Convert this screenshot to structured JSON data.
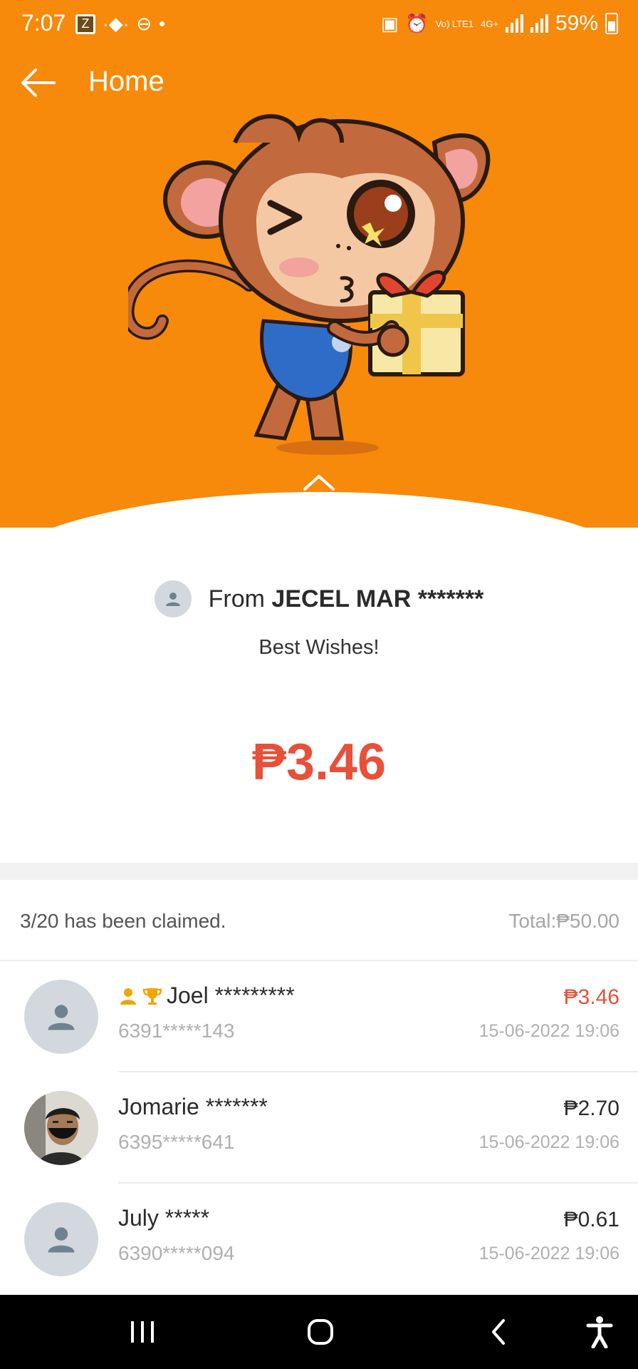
{
  "status_bar": {
    "time": "7:07",
    "carrier_badge": "Z",
    "lte_label": "Vo) LTE1",
    "net_label": "4G+",
    "battery": "59%"
  },
  "app_bar": {
    "title": "Home"
  },
  "sender": {
    "prefix": "From",
    "name": "JECEL MAR *******",
    "message": "Best Wishes!"
  },
  "received_amount": "₱3.46",
  "claims": {
    "summary": "3/20 has been claimed.",
    "total": "Total:₱50.00",
    "items": [
      {
        "name": "Joel *********",
        "phone": "6391*****143",
        "amount": "₱3.46",
        "time": "15-06-2022 19:06",
        "best": true
      },
      {
        "name": "Jomarie *******",
        "phone": "6395*****641",
        "amount": "₱2.70",
        "time": "15-06-2022 19:06",
        "best": false
      },
      {
        "name": "July *****",
        "phone": "6390*****094",
        "amount": "₱0.61",
        "time": "15-06-2022 19:06",
        "best": false
      }
    ]
  },
  "colors": {
    "brand_orange": "#f7890b",
    "amount_red": "#e8503a",
    "badge_gold": "#f0a500"
  },
  "icons": [
    "back-arrow-icon",
    "chevron-up-icon",
    "person-icon",
    "crown-icon",
    "trophy-icon",
    "recents-icon",
    "home-icon",
    "back-icon",
    "accessibility-icon"
  ]
}
